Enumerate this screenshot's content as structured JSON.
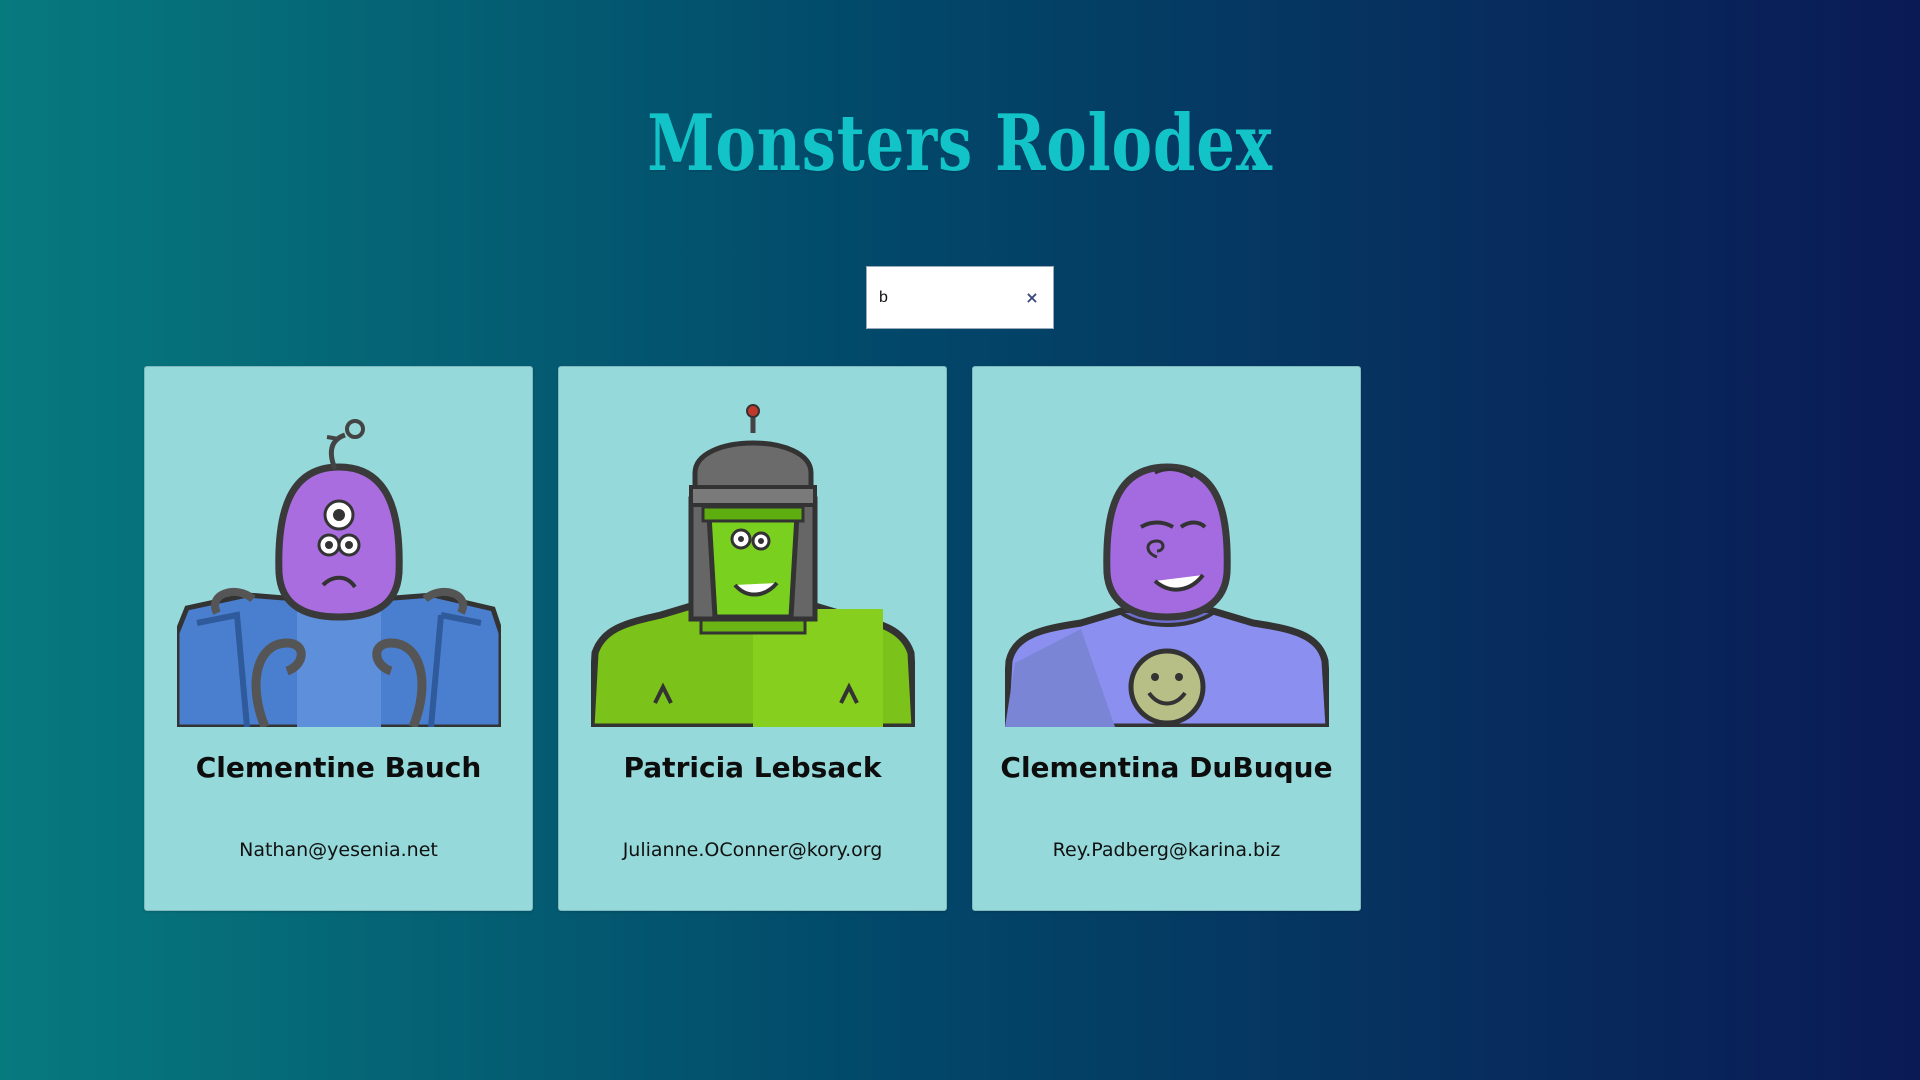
{
  "app": {
    "title": "Monsters Rolodex"
  },
  "search": {
    "value": "b",
    "clear_icon": "×"
  },
  "monsters": [
    {
      "name": "Clementine Bauch",
      "email": "Nathan@yesenia.net",
      "avatar_icon": "cyclops-robot-monster-icon"
    },
    {
      "name": "Patricia Lebsack",
      "email": "Julianne.OConner@kory.org",
      "avatar_icon": "green-helmet-robot-monster-icon"
    },
    {
      "name": "Clementina DuBuque",
      "email": "Rey.Padberg@karina.biz",
      "avatar_icon": "smiley-purple-monster-icon"
    }
  ],
  "colors": {
    "title": "#12c4c8",
    "card_background": "#95d9da",
    "background_start": "#077a7e",
    "background_end": "#0a1a55"
  }
}
